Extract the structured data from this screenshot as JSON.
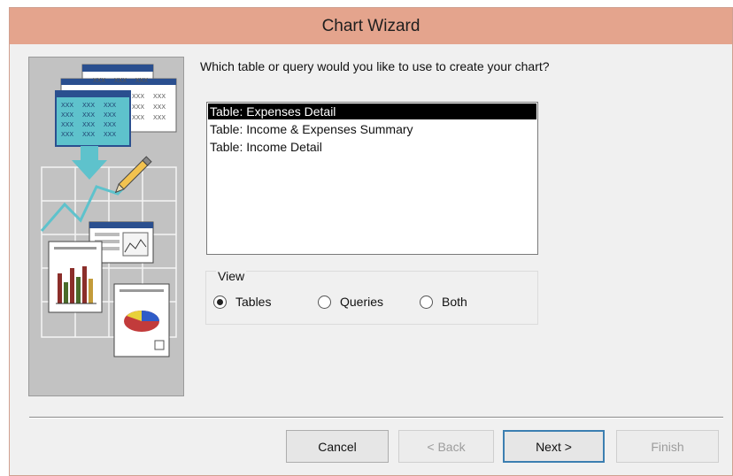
{
  "window": {
    "title": "Chart Wizard"
  },
  "prompt": "Which table or query would you like to use to create your chart?",
  "list": {
    "items": [
      "Table: Expenses Detail",
      "Table: Income & Expenses Summary",
      "Table: Income Detail"
    ],
    "selected_index": 0
  },
  "view": {
    "legend": "View",
    "options": [
      "Tables",
      "Queries",
      "Both"
    ],
    "selected": "Tables"
  },
  "buttons": {
    "cancel": "Cancel",
    "back": "< Back",
    "next": "Next >",
    "finish": "Finish"
  },
  "illustration": {
    "sheet_text": "XXX"
  },
  "colors": {
    "titlebar": "#e4a48d",
    "selection": "#000000",
    "default_button_border": "#3c7fb1"
  }
}
